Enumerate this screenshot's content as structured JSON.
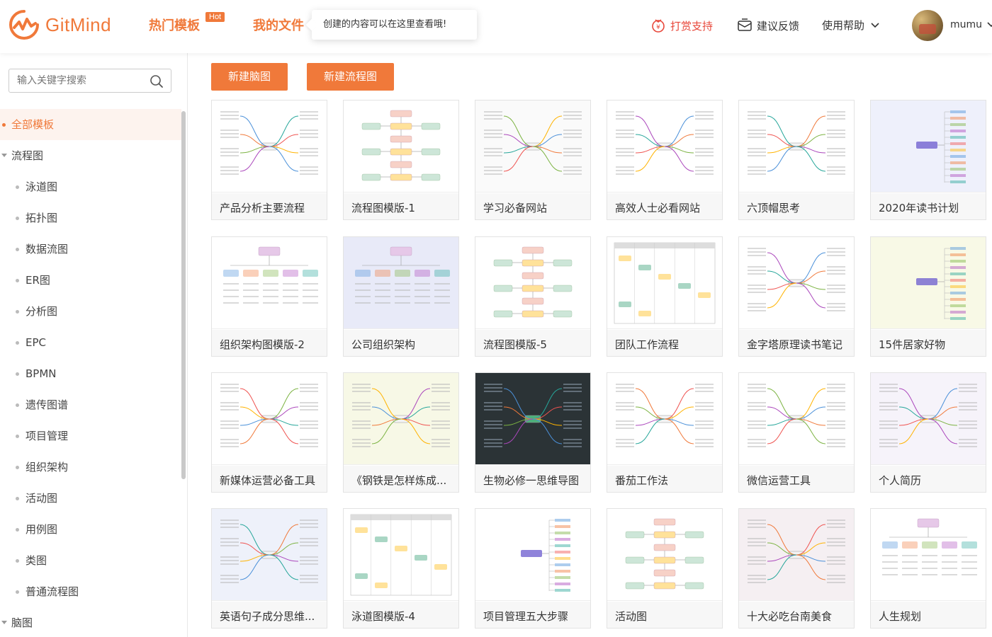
{
  "header": {
    "logo_text": "GitMind",
    "nav_hot": "热门模板",
    "hot_badge": "Hot",
    "nav_files": "我的文件",
    "tooltip": "创建的内容可以在这里查看哦!",
    "donate": "打赏支持",
    "feedback": "建议反馈",
    "help": "使用帮助",
    "username": "mumu"
  },
  "sidebar": {
    "search_placeholder": "输入关键字搜索",
    "items": [
      {
        "label": "全部模板"
      },
      {
        "label": "流程图"
      },
      {
        "label": "泳道图"
      },
      {
        "label": "拓扑图"
      },
      {
        "label": "数据流图"
      },
      {
        "label": "ER图"
      },
      {
        "label": "分析图"
      },
      {
        "label": "EPC"
      },
      {
        "label": "BPMN"
      },
      {
        "label": "遗传图谱"
      },
      {
        "label": "项目管理"
      },
      {
        "label": "组织架构"
      },
      {
        "label": "活动图"
      },
      {
        "label": "用例图"
      },
      {
        "label": "类图"
      },
      {
        "label": "普通流程图"
      },
      {
        "label": "脑图"
      }
    ]
  },
  "toolbar": {
    "new_mindmap": "新建脑图",
    "new_flowchart": "新建流程图"
  },
  "templates": [
    {
      "title": "产品分析主要流程",
      "bg": "#ffffff",
      "kind": "mind"
    },
    {
      "title": "流程图模版-1",
      "bg": "#ffffff",
      "kind": "flow"
    },
    {
      "title": "学习必备网站",
      "bg": "#fafafa",
      "kind": "mind"
    },
    {
      "title": "高效人士必看网站",
      "bg": "#ffffff",
      "kind": "mind"
    },
    {
      "title": "六顶帽思考",
      "bg": "#ffffff",
      "kind": "mind"
    },
    {
      "title": "2020年读书计划",
      "bg": "#eef0fb",
      "kind": "list"
    },
    {
      "title": "组织架构图模版-2",
      "bg": "#ffffff",
      "kind": "org"
    },
    {
      "title": "公司组织架构",
      "bg": "#e8eaf8",
      "kind": "org"
    },
    {
      "title": "流程图模版-5",
      "bg": "#ffffff",
      "kind": "flow"
    },
    {
      "title": "团队工作流程",
      "bg": "#ffffff",
      "kind": "lane"
    },
    {
      "title": "金字塔原理读书笔记",
      "bg": "#ffffff",
      "kind": "mind"
    },
    {
      "title": "15件居家好物",
      "bg": "#f8f9e6",
      "kind": "list"
    },
    {
      "title": "新媒体运营必备工具",
      "bg": "#ffffff",
      "kind": "mind"
    },
    {
      "title": "《钢铁是怎样炼成...",
      "bg": "#f7f8e6",
      "kind": "mind"
    },
    {
      "title": "生物必修一思维导图",
      "bg": "#2b3336",
      "kind": "mind"
    },
    {
      "title": "番茄工作法",
      "bg": "#ffffff",
      "kind": "mind"
    },
    {
      "title": "微信运营工具",
      "bg": "#ffffff",
      "kind": "mind"
    },
    {
      "title": "个人简历",
      "bg": "#f6f3fa",
      "kind": "mind"
    },
    {
      "title": "英语句子成分思维...",
      "bg": "#eef1fa",
      "kind": "mind"
    },
    {
      "title": "泳道图模版-4",
      "bg": "#ffffff",
      "kind": "lane"
    },
    {
      "title": "项目管理五大步骤",
      "bg": "#ffffff",
      "kind": "list"
    },
    {
      "title": "活动图",
      "bg": "#ffffff",
      "kind": "flow"
    },
    {
      "title": "十大必吃台南美食",
      "bg": "#f5eff2",
      "kind": "mind"
    },
    {
      "title": "人生规划",
      "bg": "#ffffff",
      "kind": "org"
    }
  ],
  "colors": {
    "accent": "#f0793a",
    "donate": "#e8473a"
  }
}
